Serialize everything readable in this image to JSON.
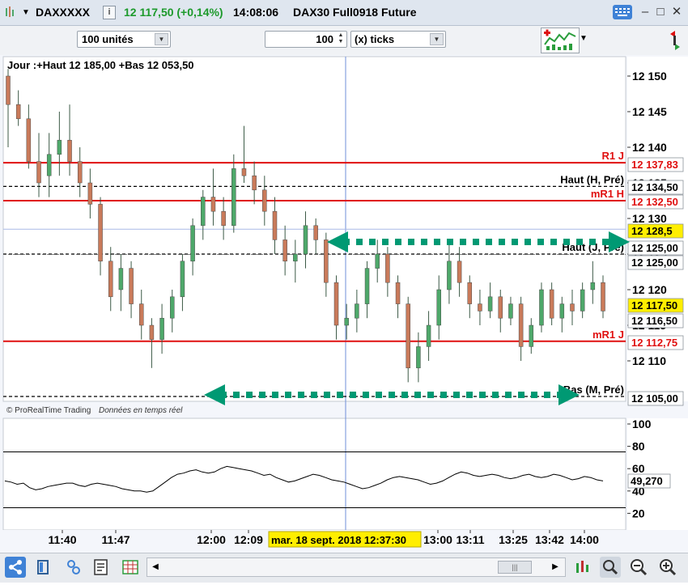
{
  "titlebar": {
    "symbol": "DAXXXXX",
    "info_glyph": "i",
    "price_change": "12 117,50 (+0,14%)",
    "time": "14:08:06",
    "instrument": "DAX30 Full0918 Future"
  },
  "toolbar": {
    "quantity": "100 unités",
    "tick_count": "100",
    "tick_unit": "(x) ticks"
  },
  "chart": {
    "header": "Jour :+Haut 12 185,00 +Bas 12 053,50",
    "footer_brand": "© ProRealTime Trading",
    "footer_note": "Données en temps réel",
    "crosshair_label": "mar. 18 sept. 2018 12:37:30",
    "price_axis_ticks": [
      "12 150",
      "12 145",
      "12 140",
      "12 135",
      "12 130",
      "12 125",
      "12 120",
      "12 115",
      "12 110"
    ],
    "time_axis_ticks": [
      "11:40",
      "11:47",
      "12:00",
      "12:09",
      "13:00",
      "13:11",
      "13:25",
      "13:42",
      "14:00"
    ],
    "osc_axis_ticks": [
      "100",
      "80",
      "60",
      "40",
      "20"
    ],
    "osc_value": "49,270"
  },
  "levels": [
    {
      "label": "R1 J",
      "badge": "12 137,83",
      "style": "red"
    },
    {
      "label": "Haut (H, Pré)",
      "badge": "12 134,50",
      "style": "dash"
    },
    {
      "label": "mR1 H",
      "badge": "12 132,50",
      "style": "red"
    },
    {
      "label": "",
      "badge": "12 128,5",
      "style": "yellow"
    },
    {
      "label": "Haut (J, Pré)",
      "badge": "12 125,00",
      "style": "dash"
    },
    {
      "label": "",
      "badge": "12 125,00",
      "style": "plain"
    },
    {
      "label": "",
      "badge": "12 117,50",
      "style": "yellow"
    },
    {
      "label": "",
      "badge": "12 116,50",
      "style": "plain"
    },
    {
      "label": "mR1 J",
      "badge": "12 112,75",
      "style": "red"
    },
    {
      "label": "Bas (M, Pré)",
      "badge": "12 105,00",
      "style": "dash"
    }
  ],
  "colors": {
    "bull": "#4ea86a",
    "bear": "#c97a5a",
    "resistance": "#e01010",
    "annotation": "#009973",
    "crosshair": "#6f8fd8",
    "highlight": "#ffee00"
  },
  "chart_data": {
    "type": "candlestick",
    "ylim": [
      12104,
      12152
    ],
    "ohlc": [
      {
        "o": 12150,
        "h": 12151,
        "l": 12140,
        "c": 12146
      },
      {
        "o": 12146,
        "h": 12148,
        "l": 12143,
        "c": 12144
      },
      {
        "o": 12144,
        "h": 12146,
        "l": 12137,
        "c": 12138
      },
      {
        "o": 12138,
        "h": 12142,
        "l": 12133,
        "c": 12135
      },
      {
        "o": 12136,
        "h": 12142,
        "l": 12133,
        "c": 12139
      },
      {
        "o": 12139,
        "h": 12145,
        "l": 12136,
        "c": 12141
      },
      {
        "o": 12141,
        "h": 12146,
        "l": 12136,
        "c": 12138
      },
      {
        "o": 12138,
        "h": 12140,
        "l": 12133,
        "c": 12135
      },
      {
        "o": 12135,
        "h": 12137,
        "l": 12130,
        "c": 12132
      },
      {
        "o": 12132,
        "h": 12133,
        "l": 12122,
        "c": 12124
      },
      {
        "o": 12124,
        "h": 12126,
        "l": 12117,
        "c": 12119
      },
      {
        "o": 12120,
        "h": 12125,
        "l": 12117,
        "c": 12123
      },
      {
        "o": 12123,
        "h": 12124,
        "l": 12116,
        "c": 12118
      },
      {
        "o": 12118,
        "h": 12120,
        "l": 12113,
        "c": 12115
      },
      {
        "o": 12115,
        "h": 12116,
        "l": 12109,
        "c": 12113
      },
      {
        "o": 12113,
        "h": 12118,
        "l": 12111,
        "c": 12116
      },
      {
        "o": 12116,
        "h": 12120,
        "l": 12114,
        "c": 12119
      },
      {
        "o": 12119,
        "h": 12125,
        "l": 12117,
        "c": 12124
      },
      {
        "o": 12124,
        "h": 12130,
        "l": 12122,
        "c": 12129
      },
      {
        "o": 12129,
        "h": 12134,
        "l": 12127,
        "c": 12133
      },
      {
        "o": 12133,
        "h": 12137,
        "l": 12129,
        "c": 12131
      },
      {
        "o": 12131,
        "h": 12133,
        "l": 12127,
        "c": 12129
      },
      {
        "o": 12129,
        "h": 12139,
        "l": 12128,
        "c": 12137
      },
      {
        "o": 12137,
        "h": 12143,
        "l": 12135,
        "c": 12136
      },
      {
        "o": 12136,
        "h": 12138,
        "l": 12132,
        "c": 12134
      },
      {
        "o": 12134,
        "h": 12136,
        "l": 12129,
        "c": 12131
      },
      {
        "o": 12131,
        "h": 12133,
        "l": 12125,
        "c": 12127
      },
      {
        "o": 12127,
        "h": 12129,
        "l": 12122,
        "c": 12124
      },
      {
        "o": 12124,
        "h": 12127,
        "l": 12121,
        "c": 12125
      },
      {
        "o": 12125,
        "h": 12131,
        "l": 12123,
        "c": 12129
      },
      {
        "o": 12129,
        "h": 12130,
        "l": 12125,
        "c": 12127
      },
      {
        "o": 12127,
        "h": 12128,
        "l": 12119,
        "c": 12121
      },
      {
        "o": 12121,
        "h": 12122,
        "l": 12113,
        "c": 12115
      },
      {
        "o": 12115,
        "h": 12118,
        "l": 12113,
        "c": 12116
      },
      {
        "o": 12116,
        "h": 12120,
        "l": 12114,
        "c": 12118
      },
      {
        "o": 12118,
        "h": 12124,
        "l": 12116,
        "c": 12123
      },
      {
        "o": 12123,
        "h": 12127,
        "l": 12121,
        "c": 12125
      },
      {
        "o": 12125,
        "h": 12126,
        "l": 12119,
        "c": 12121
      },
      {
        "o": 12121,
        "h": 12122,
        "l": 12116,
        "c": 12118
      },
      {
        "o": 12118,
        "h": 12119,
        "l": 12107,
        "c": 12109
      },
      {
        "o": 12109,
        "h": 12114,
        "l": 12107,
        "c": 12112
      },
      {
        "o": 12112,
        "h": 12117,
        "l": 12110,
        "c": 12115
      },
      {
        "o": 12115,
        "h": 12122,
        "l": 12113,
        "c": 12120
      },
      {
        "o": 12120,
        "h": 12127,
        "l": 12118,
        "c": 12124
      },
      {
        "o": 12124,
        "h": 12126,
        "l": 12119,
        "c": 12121
      },
      {
        "o": 12121,
        "h": 12122,
        "l": 12116,
        "c": 12118
      },
      {
        "o": 12118,
        "h": 12120,
        "l": 12115,
        "c": 12117
      },
      {
        "o": 12117,
        "h": 12121,
        "l": 12116,
        "c": 12119
      },
      {
        "o": 12119,
        "h": 12120,
        "l": 12114,
        "c": 12116
      },
      {
        "o": 12116,
        "h": 12119,
        "l": 12115,
        "c": 12118
      },
      {
        "o": 12118,
        "h": 12119,
        "l": 12110,
        "c": 12112
      },
      {
        "o": 12112,
        "h": 12116,
        "l": 12111,
        "c": 12115
      },
      {
        "o": 12115,
        "h": 12121,
        "l": 12114,
        "c": 12120
      },
      {
        "o": 12120,
        "h": 12121,
        "l": 12115,
        "c": 12116
      },
      {
        "o": 12116,
        "h": 12119,
        "l": 12114,
        "c": 12118
      },
      {
        "o": 12118,
        "h": 12120,
        "l": 12115,
        "c": 12117
      },
      {
        "o": 12117,
        "h": 12121,
        "l": 12116,
        "c": 12120
      },
      {
        "o": 12120,
        "h": 12124,
        "l": 12118,
        "c": 12121
      },
      {
        "o": 12121,
        "h": 12122,
        "l": 12116,
        "c": 12117
      }
    ],
    "oscillator": [
      49,
      48,
      46,
      47,
      43,
      41,
      42,
      44,
      45,
      46,
      47,
      47,
      45,
      44,
      46,
      47,
      46,
      45,
      44,
      42,
      41,
      40,
      40,
      39,
      40,
      44,
      48,
      52,
      55,
      56,
      58,
      59,
      57,
      56,
      57,
      60,
      62,
      61,
      60,
      59,
      58,
      56,
      54,
      55,
      52,
      50,
      48,
      49,
      51,
      53,
      55,
      54,
      52,
      50,
      49,
      48,
      46,
      44,
      42,
      43,
      45,
      47,
      50,
      52,
      53,
      52,
      51,
      50,
      48,
      46,
      47,
      49,
      52,
      55,
      57,
      56,
      54,
      53,
      54,
      55,
      54,
      52,
      51,
      52,
      54,
      55,
      53,
      52,
      53,
      55,
      54,
      52,
      50,
      51,
      53,
      52,
      50,
      49
    ],
    "osc_levels": [
      75,
      25
    ]
  }
}
